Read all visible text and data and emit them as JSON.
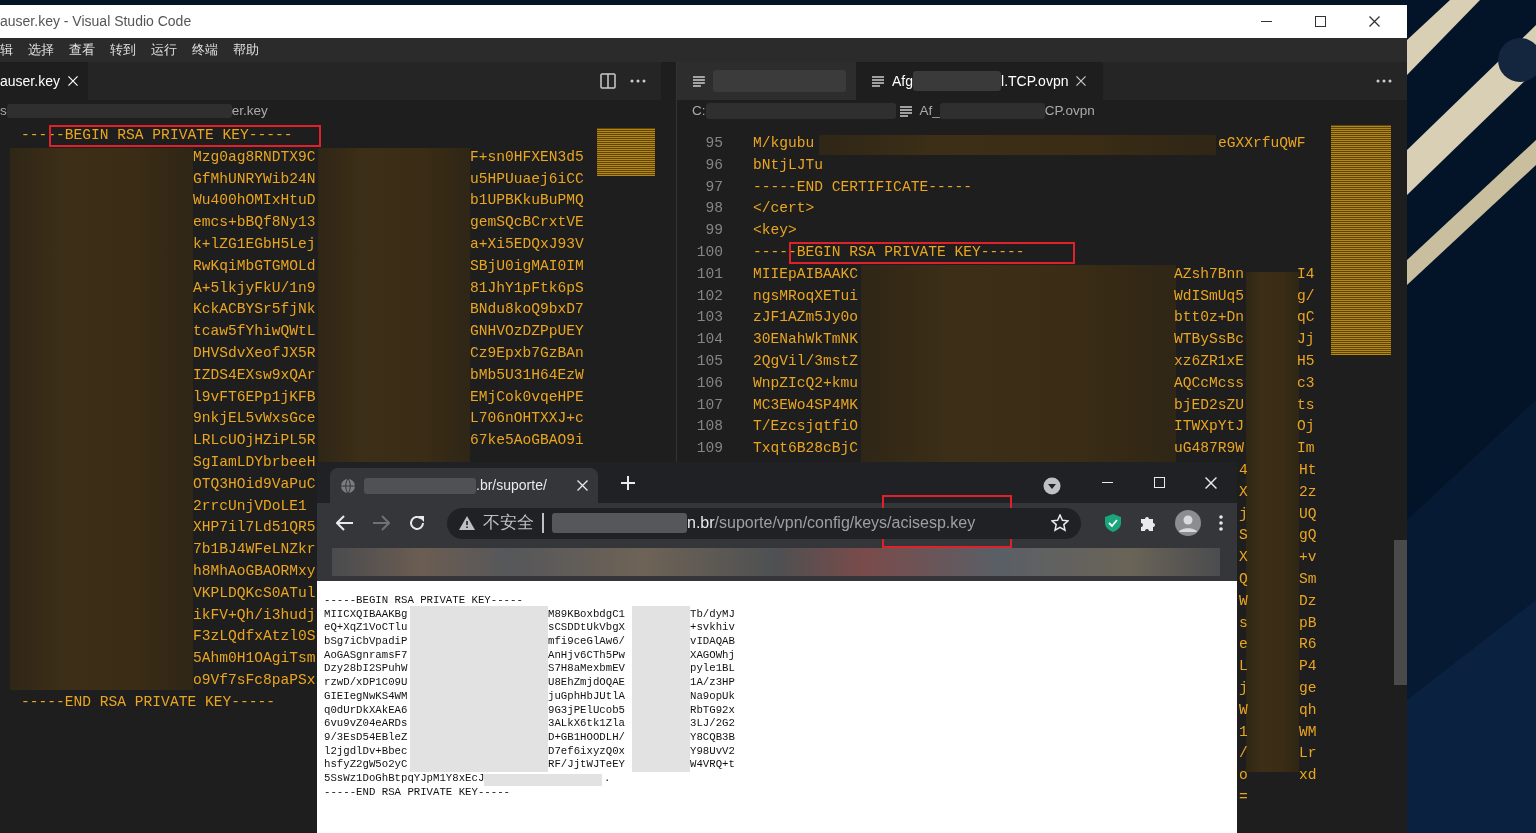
{
  "editor": {
    "title": "auser.key - Visual Studio Code",
    "menu": [
      "辑",
      "选择",
      "查看",
      "转到",
      "运行",
      "终端",
      "帮助"
    ],
    "left_pane": {
      "tabs": [
        {
          "label": "auser.key",
          "selected": true
        }
      ],
      "breadcrumb": [
        "s",
        "er.key"
      ],
      "lines": [
        {
          "kind": "plain",
          "text": "-----BEGIN RSA PRIVATE KEY-----",
          "boxed": true
        },
        {
          "kind": "split",
          "segments": [
            "Mzg0ag8RNDTX9C",
            "F+sn0HFXEN3d5"
          ]
        },
        {
          "kind": "split",
          "segments": [
            "GfMhUNRYWib24N",
            "u5HPUuaej6iCC"
          ]
        },
        {
          "kind": "split",
          "segments": [
            "Wu400hOMIxHtuD",
            "b1UPBKkuBuPMQ"
          ]
        },
        {
          "kind": "split",
          "segments": [
            "emcs+bBQf8Ny13",
            "gemSQcBCrxtVE"
          ]
        },
        {
          "kind": "split",
          "segments": [
            "k+lZG1EGbH5Lej",
            "a+Xi5EDQxJ93V"
          ]
        },
        {
          "kind": "split",
          "segments": [
            "RwKqiMbGTGMOLd",
            "SBjU0igMAI0IM"
          ]
        },
        {
          "kind": "split",
          "segments": [
            "A+5lkjyFkU/1n9",
            "81JhY1pFtk6pS"
          ]
        },
        {
          "kind": "split",
          "segments": [
            "KckACBYSr5fjNk",
            "BNdu8koQ9bxD7"
          ]
        },
        {
          "kind": "split",
          "segments": [
            "tcaw5fYhiwQWtL",
            "GNHVOzDZPpUEY"
          ]
        },
        {
          "kind": "split",
          "segments": [
            "DHVSdvXeofJX5R",
            "Cz9Epxb7GzBAn"
          ]
        },
        {
          "kind": "split",
          "segments": [
            "IZDS4EXsw9xQAr",
            "bMb5U31H64EzW"
          ]
        },
        {
          "kind": "split",
          "segments": [
            "l9vFT6EPp1jKFB",
            "EMjCok0vqeHPE"
          ]
        },
        {
          "kind": "split",
          "segments": [
            "9nkjEL5vWxsGce",
            "L706nOHTXXJ+c"
          ]
        },
        {
          "kind": "split",
          "segments": [
            "LRLcUOjHZiPL5R",
            "67ke5AoGBAO9i"
          ]
        },
        {
          "kind": "split",
          "segments": [
            "SgIamLDYbrbeeH"
          ]
        },
        {
          "kind": "split",
          "segments": [
            "OTQ3HOid9VaPuC"
          ]
        },
        {
          "kind": "split",
          "segments": [
            "2rrcUnjVDoLE1"
          ]
        },
        {
          "kind": "split",
          "segments": [
            "XHP7il7Ld51QR5"
          ]
        },
        {
          "kind": "split",
          "segments": [
            "7b1BJ4WFeLNZkr"
          ]
        },
        {
          "kind": "split",
          "segments": [
            "h8MhAoGBAORMxy"
          ]
        },
        {
          "kind": "split",
          "segments": [
            "VKPLDQKcS0ATul"
          ]
        },
        {
          "kind": "split",
          "segments": [
            "ikFV+Qh/i3hudj"
          ]
        },
        {
          "kind": "split",
          "segments": [
            "F3zLQdfxAtzl0S"
          ]
        },
        {
          "kind": "split",
          "segments": [
            "5Ahm0H1OAgiTsm"
          ]
        },
        {
          "kind": "split",
          "segments": [
            "o9Vf7sFc8paPSx"
          ]
        },
        {
          "kind": "plain",
          "text": "-----END RSA PRIVATE KEY-----",
          "boxed": false
        }
      ]
    },
    "right_pane": {
      "tabs": [
        {
          "selected": false
        },
        {
          "label_start": "Afg",
          "label_end": "l.TCP.ovpn",
          "selected": true
        }
      ],
      "breadcrumb": [
        {
          "kind": "folder",
          "text": "C:"
        },
        {
          "kind": "file",
          "text": "Af_"
        },
        {
          "kind": "tail",
          "text": "CP.ovpn"
        }
      ],
      "lines": [
        {
          "kind": "cert",
          "number": "95",
          "segments": [
            "M/kgubu",
            "eGXXrfuQWF"
          ]
        },
        {
          "kind": "plain",
          "number": "96",
          "text": "bNtjLJTu",
          "boxed": false
        },
        {
          "kind": "plain",
          "number": "97",
          "text": "-----END CERTIFICATE-----",
          "boxed": false
        },
        {
          "kind": "plain",
          "number": "98",
          "text": "</cert>",
          "boxed": false
        },
        {
          "kind": "plain",
          "number": "99",
          "text": "<key>",
          "boxed": false
        },
        {
          "kind": "plain",
          "number": "100",
          "text": "-----BEGIN RSA PRIVATE KEY-----",
          "boxed": true
        },
        {
          "kind": "key",
          "number": "101",
          "segments": [
            "MIIEpAIBAAKC",
            "AZsh7Bnn",
            "I4"
          ]
        },
        {
          "kind": "key",
          "number": "102",
          "segments": [
            "ngsMRoqXETui",
            "WdISmUq5",
            "g/"
          ]
        },
        {
          "kind": "key",
          "number": "103",
          "segments": [
            "zJF1AZm5Jy0o",
            "btt0z+Dn",
            "qC"
          ]
        },
        {
          "kind": "key",
          "number": "104",
          "segments": [
            "30ENahWkTmNK",
            "WTBySsBc",
            "Jj"
          ]
        },
        {
          "kind": "key",
          "number": "105",
          "segments": [
            "2QgVil/3mstZ",
            "xz6ZR1xE",
            "H5"
          ]
        },
        {
          "kind": "key",
          "number": "106",
          "segments": [
            "WnpZIcQ2+kmu",
            "AQCcMcss",
            "c3"
          ]
        },
        {
          "kind": "key",
          "number": "107",
          "segments": [
            "MC3EWo4SP4MK",
            "bjED2sZU",
            "ts"
          ]
        },
        {
          "kind": "key",
          "number": "108",
          "segments": [
            "T/EzcsjqtfiO",
            "ITWXpYtJ",
            "Oj"
          ]
        },
        {
          "kind": "key",
          "number": "109",
          "segments": [
            "Txqt6B28cBjC",
            "uG487R9W",
            "Im"
          ]
        },
        {
          "kind": "edge",
          "segments": [
            "4",
            "Ht"
          ]
        },
        {
          "kind": "edge",
          "segments": [
            "X",
            "2z"
          ]
        },
        {
          "kind": "edge",
          "segments": [
            "j",
            "UQ"
          ]
        },
        {
          "kind": "edge",
          "segments": [
            "S",
            "gQ"
          ]
        },
        {
          "kind": "edge",
          "segments": [
            "X",
            "+v"
          ]
        },
        {
          "kind": "edge",
          "segments": [
            "Q",
            "Sm"
          ]
        },
        {
          "kind": "edge",
          "segments": [
            "W",
            "Dz"
          ]
        },
        {
          "kind": "edge",
          "segments": [
            "s",
            "pB"
          ]
        },
        {
          "kind": "edge",
          "segments": [
            "e",
            "R6"
          ]
        },
        {
          "kind": "edge",
          "segments": [
            "L",
            "P4"
          ]
        },
        {
          "kind": "edge",
          "segments": [
            "j",
            "ge"
          ]
        },
        {
          "kind": "edge",
          "segments": [
            "W",
            "qh"
          ]
        },
        {
          "kind": "edge",
          "segments": [
            "1",
            "WM"
          ]
        },
        {
          "kind": "edge",
          "segments": [
            "/",
            "Lr"
          ]
        },
        {
          "kind": "edge",
          "segments": [
            "o",
            "xd"
          ]
        },
        {
          "kind": "edge",
          "segments": [
            "="
          ]
        }
      ]
    }
  },
  "browser": {
    "tab": {
      "title_end": ".br/suporte/"
    },
    "nav": [
      {
        "kind": "back",
        "disabled": false
      },
      {
        "kind": "forward",
        "disabled": true
      },
      {
        "kind": "reload",
        "disabled": false
      }
    ],
    "address": {
      "security": "不安全",
      "host_end": "n.br",
      "path": "/suporte/vpn/config/keys/acisesp.key",
      "boxed": true
    },
    "content": [
      {
        "kind": "plain",
        "text": "-----BEGIN RSA PRIVATE KEY-----"
      },
      {
        "kind": "split",
        "segments": [
          "MIICXQIBAAKBg",
          "M89KBoxbdgC1",
          "Tb/dyMJ"
        ]
      },
      {
        "kind": "split",
        "segments": [
          "eQ+XqZ1VoCTlu",
          "sCSDDtUkVbgX",
          "+svkhiv"
        ]
      },
      {
        "kind": "split",
        "segments": [
          "bSg7iCbVpadiP",
          "mfi9ceGlAw6/",
          "vIDAQAB"
        ]
      },
      {
        "kind": "split",
        "segments": [
          "AoGASgnramsF7",
          "AnHjv6CTh5Pw",
          "XAGOWhj"
        ]
      },
      {
        "kind": "split",
        "segments": [
          "Dzy28bI2SPuhW",
          "S7H8aMexbmEV",
          "pyle1BL"
        ]
      },
      {
        "kind": "split",
        "segments": [
          "rzwD/xDP1C09U",
          "U8EhZmjdOQAE",
          "1A/z3HP"
        ]
      },
      {
        "kind": "split",
        "segments": [
          "GIEIegNwKS4WM",
          "juGphHbJUtlA",
          "Na9opUk"
        ]
      },
      {
        "kind": "split",
        "segments": [
          "q0dUrDkXAkEA6",
          "9G3jPElUcob5",
          "RbTG92x"
        ]
      },
      {
        "kind": "split",
        "segments": [
          "6vu9vZ04eARDs",
          "3ALkX6tk1Zla",
          "3LJ/2G2"
        ]
      },
      {
        "kind": "split",
        "segments": [
          "9/3EsD54EBleZ",
          "D+GB1HOODLH/",
          "Y8CQB3B"
        ]
      },
      {
        "kind": "split",
        "segments": [
          "l2jgdlDv+Bbec",
          "D7ef6ixyzQ0x",
          "Y98UvV2"
        ]
      },
      {
        "kind": "split",
        "segments": [
          "hsfyZ2gW5o2yC",
          "RF/JjtWJTeEY",
          "W4VRQ+t"
        ]
      },
      {
        "kind": "tail",
        "segments": [
          "5SsWz1DoGhBtpqYJpM1Y8xEcJ",
          "."
        ]
      },
      {
        "kind": "plain",
        "text": "-----END RSA PRIVATE KEY-----"
      }
    ]
  }
}
